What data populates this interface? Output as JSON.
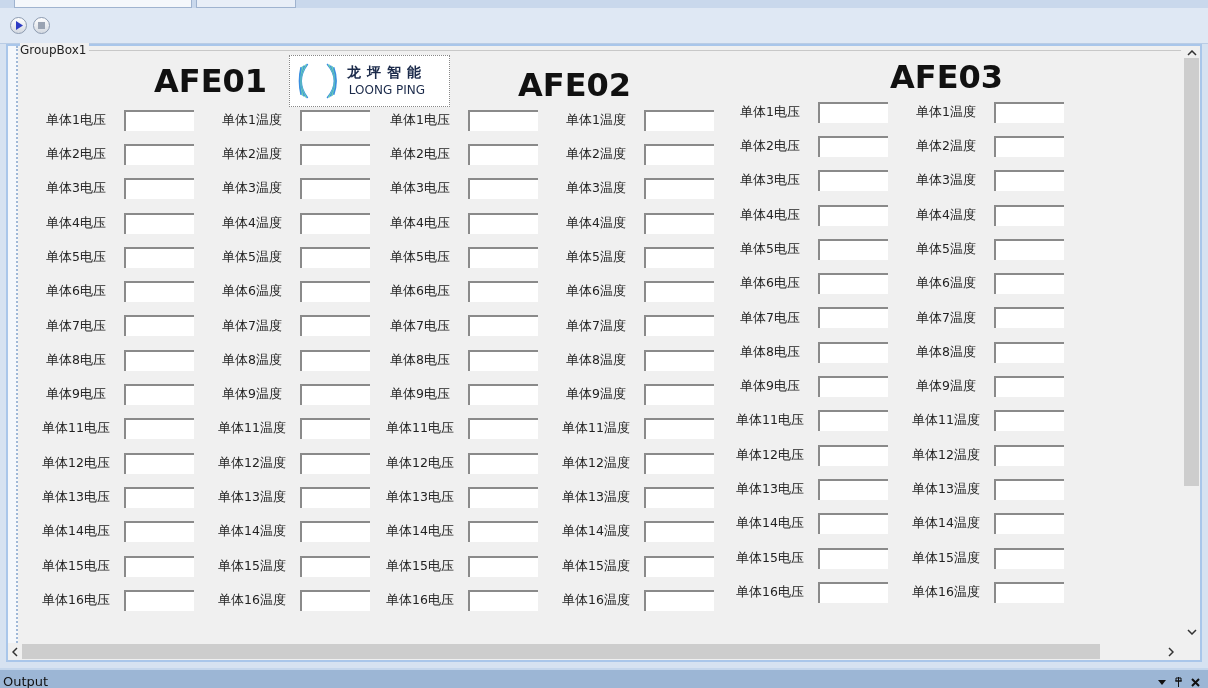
{
  "group_box": {
    "title": "GroupBox1"
  },
  "logo": {
    "chinese": "龙坪智能",
    "english": "LOONG PING"
  },
  "sections": [
    {
      "title": "AFE01",
      "rows": [
        {
          "voltage": "单体1电压",
          "temperature": "单体1温度"
        },
        {
          "voltage": "单体2电压",
          "temperature": "单体2温度"
        },
        {
          "voltage": "单体3电压",
          "temperature": "单体3温度"
        },
        {
          "voltage": "单体4电压",
          "temperature": "单体4温度"
        },
        {
          "voltage": "单体5电压",
          "temperature": "单体5温度"
        },
        {
          "voltage": "单体6电压",
          "temperature": "单体6温度"
        },
        {
          "voltage": "单体7电压",
          "temperature": "单体7温度"
        },
        {
          "voltage": "单体8电压",
          "temperature": "单体8温度"
        },
        {
          "voltage": "单体9电压",
          "temperature": "单体9温度"
        },
        {
          "voltage": "单体11电压",
          "temperature": "单体11温度"
        },
        {
          "voltage": "单体12电压",
          "temperature": "单体12温度"
        },
        {
          "voltage": "单体13电压",
          "temperature": "单体13温度"
        },
        {
          "voltage": "单体14电压",
          "temperature": "单体14温度"
        },
        {
          "voltage": "单体15电压",
          "temperature": "单体15温度"
        },
        {
          "voltage": "单体16电压",
          "temperature": "单体16温度"
        }
      ]
    },
    {
      "title": "AFE02",
      "rows": [
        {
          "voltage": "单体1电压",
          "temperature": "单体1温度"
        },
        {
          "voltage": "单体2电压",
          "temperature": "单体2温度"
        },
        {
          "voltage": "单体3电压",
          "temperature": "单体3温度"
        },
        {
          "voltage": "单体4电压",
          "temperature": "单体4温度"
        },
        {
          "voltage": "单体5电压",
          "temperature": "单体5温度"
        },
        {
          "voltage": "单体6电压",
          "temperature": "单体6温度"
        },
        {
          "voltage": "单体7电压",
          "temperature": "单体7温度"
        },
        {
          "voltage": "单体8电压",
          "temperature": "单体8温度"
        },
        {
          "voltage": "单体9电压",
          "temperature": "单体9温度"
        },
        {
          "voltage": "单体11电压",
          "temperature": "单体11温度"
        },
        {
          "voltage": "单体12电压",
          "temperature": "单体12温度"
        },
        {
          "voltage": "单体13电压",
          "temperature": "单体13温度"
        },
        {
          "voltage": "单体14电压",
          "temperature": "单体14温度"
        },
        {
          "voltage": "单体15电压",
          "temperature": "单体15温度"
        },
        {
          "voltage": "单体16电压",
          "temperature": "单体16温度"
        }
      ]
    },
    {
      "title": "AFE03",
      "rows": [
        {
          "voltage": "单体1电压",
          "temperature": "单体1温度"
        },
        {
          "voltage": "单体2电压",
          "temperature": "单体2温度"
        },
        {
          "voltage": "单体3电压",
          "temperature": "单体3温度"
        },
        {
          "voltage": "单体4电压",
          "temperature": "单体4温度"
        },
        {
          "voltage": "单体5电压",
          "temperature": "单体5温度"
        },
        {
          "voltage": "单体6电压",
          "temperature": "单体6温度"
        },
        {
          "voltage": "单体7电压",
          "temperature": "单体7温度"
        },
        {
          "voltage": "单体8电压",
          "temperature": "单体8温度"
        },
        {
          "voltage": "单体9电压",
          "temperature": "单体9温度"
        },
        {
          "voltage": "单体11电压",
          "temperature": "单体11温度"
        },
        {
          "voltage": "单体12电压",
          "temperature": "单体12温度"
        },
        {
          "voltage": "单体13电压",
          "temperature": "单体13温度"
        },
        {
          "voltage": "单体14电压",
          "temperature": "单体14温度"
        },
        {
          "voltage": "单体15电压",
          "temperature": "单体15温度"
        },
        {
          "voltage": "单体16电压",
          "temperature": "单体16温度"
        }
      ]
    }
  ],
  "output_panel": {
    "title": "Output"
  }
}
